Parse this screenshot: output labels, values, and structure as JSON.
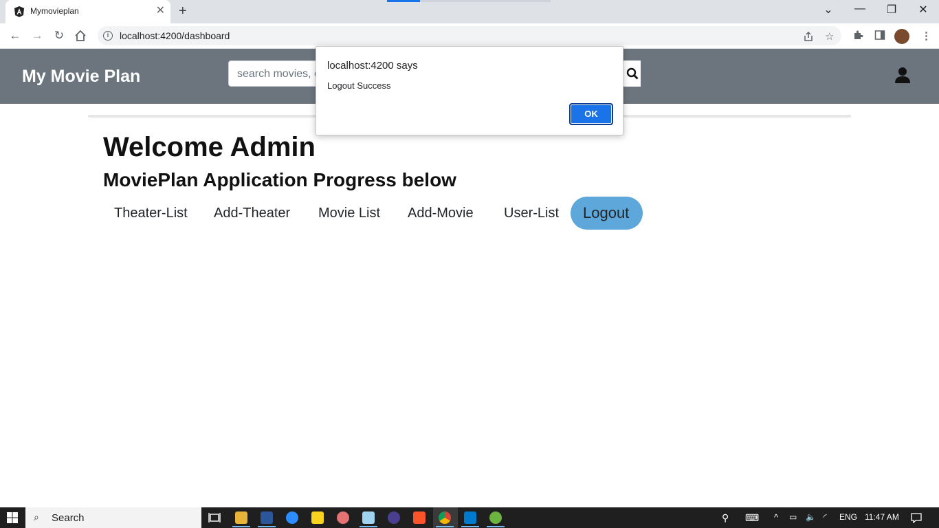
{
  "browser": {
    "tab_title": "Mymovieplan",
    "tab_close": "✕",
    "new_tab": "+",
    "url": "localhost:4200/dashboard",
    "window_controls": [
      "⌄",
      "—",
      "❐",
      "✕"
    ]
  },
  "navbar": {
    "brand": "My Movie Plan",
    "search_placeholder": "search movies, e"
  },
  "main": {
    "welcome": "Welcome Admin",
    "subtitle": "MoviePlan Application Progress below",
    "links": [
      {
        "label": "Theater-List"
      },
      {
        "label": "Add-Theater"
      },
      {
        "label": "Movie List"
      },
      {
        "label": "Add-Movie"
      },
      {
        "label": "User-List"
      },
      {
        "label": "Logout",
        "active": true
      }
    ]
  },
  "dialog": {
    "title": "localhost:4200 says",
    "message": "Logout Success",
    "ok_label": "OK"
  },
  "taskbar": {
    "search_label": "Search",
    "language": "ENG",
    "time": "11:47 AM"
  },
  "colors": {
    "navbar_bg": "#6c757d",
    "active_link_bg": "#5ea7db",
    "dialog_button": "#1a73e8"
  }
}
